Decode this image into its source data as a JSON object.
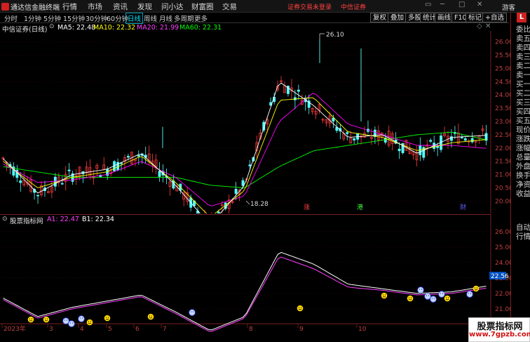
{
  "app": {
    "title": "通达信金融终端",
    "promo": "证券交易未登录",
    "broker": "中信证券",
    "guest": "游客"
  },
  "menu": [
    "行情",
    "市场",
    "资讯",
    "发现",
    "问小达",
    "财富圈",
    "交易"
  ],
  "window_controls": [
    "▭",
    "─",
    "□",
    "✕"
  ],
  "toolbar": {
    "periods": [
      "分时",
      "1分钟",
      "5分钟",
      "15分钟",
      "30分钟",
      "60分钟",
      "日线",
      "周线",
      "月线",
      "多周期",
      "更多"
    ],
    "active": "日线",
    "right_buttons": [
      "复权",
      "叠加",
      "多股",
      "统计",
      "画线",
      "F10",
      "标记",
      "+自选"
    ]
  },
  "stock": {
    "name": "中信证券(日线)",
    "ma5": "MA5: 22.48",
    "ma10": "MA10: 22.32",
    "ma20": "MA20: 21.99",
    "ma60": "MA60: 22.31"
  },
  "indicator": {
    "name": "股票指标网",
    "a1": "A1: 22.47",
    "b1": "B1: 22.34",
    "last_value": "22.56"
  },
  "annotations": {
    "high": "26.10",
    "low": "18.28",
    "markers": [
      "涨",
      "港",
      "财"
    ]
  },
  "right_panel": [
    "委比",
    "卖五",
    "卖四",
    "卖三",
    "卖二",
    "卖一",
    "买一",
    "买二",
    "买三",
    "买四",
    "买五",
    "现价",
    "涨跌",
    "涨幅",
    "总量",
    "外盘",
    "换手",
    "净资",
    "收益"
  ],
  "right_panel2": [
    "自动",
    "行情"
  ],
  "corner": "L",
  "price_axis": [
    "26.00",
    "25.50",
    "25.00",
    "24.50",
    "24.00",
    "23.50",
    "23.00",
    "22.50",
    "22.00",
    "21.50",
    "21.00",
    "20.50",
    "20.00"
  ],
  "indicator_axis": [
    "26.00",
    "25.00",
    "24.00",
    "23.00",
    "22.00",
    "21.00"
  ],
  "time_axis": [
    "2023年",
    "3",
    "4",
    "5",
    "6",
    "7",
    "8",
    "9",
    "10"
  ],
  "watermark": {
    "line1": "股票指标网",
    "line2": "www.7gpzb.com"
  },
  "colors": {
    "up": "#ff3c3c",
    "down": "#54ffff",
    "ma5": "#ffffff",
    "ma10": "#ffff00",
    "ma20": "#ff00ff",
    "ma60": "#00ff00"
  },
  "chart_data": {
    "type": "line",
    "x": [
      "2023-02",
      "2023-03",
      "2023-04",
      "2023-05",
      "2023-06",
      "2023-07",
      "2023-08",
      "2023-09",
      "2023-10",
      "2023-11"
    ],
    "ylim": [
      19.8,
      26.2
    ],
    "series": [
      {
        "name": "MA5",
        "values": [
          21.6,
          20.3,
          21.0,
          21.2,
          21.8,
          20.6,
          19.1,
          20.6,
          24.5,
          23.6,
          22.4,
          22.5,
          21.8,
          22.4,
          22.48
        ]
      },
      {
        "name": "MA10",
        "values": [
          21.5,
          20.5,
          20.9,
          21.1,
          21.7,
          20.7,
          19.4,
          20.4,
          23.8,
          23.9,
          22.6,
          22.4,
          21.9,
          22.2,
          22.32
        ]
      },
      {
        "name": "MA20",
        "values": [
          21.4,
          20.7,
          20.8,
          21.0,
          21.5,
          20.9,
          19.8,
          20.2,
          23.0,
          24.1,
          22.9,
          22.5,
          22.1,
          22.1,
          21.99
        ]
      },
      {
        "name": "MA60",
        "values": [
          21.3,
          21.1,
          20.9,
          20.9,
          20.9,
          20.9,
          20.6,
          20.5,
          21.3,
          21.9,
          22.1,
          22.3,
          22.5,
          22.6,
          22.31
        ]
      },
      {
        "name": "A1",
        "values": [
          21.7,
          20.5,
          21.1,
          21.5,
          21.9,
          20.8,
          19.6,
          20.5,
          24.7,
          23.9,
          22.6,
          22.3,
          22.0,
          22.1,
          22.47
        ]
      },
      {
        "name": "B1",
        "values": [
          21.6,
          20.4,
          21.0,
          21.4,
          21.8,
          20.7,
          19.5,
          20.4,
          24.4,
          23.6,
          22.4,
          22.2,
          21.9,
          22.0,
          22.34
        ]
      }
    ]
  }
}
